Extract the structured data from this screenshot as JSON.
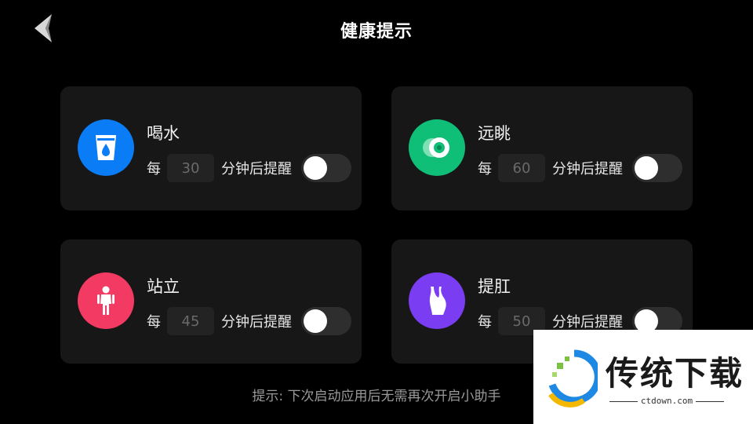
{
  "header": {
    "title": "健康提示",
    "back_icon": "chevron-left-icon"
  },
  "reminders": [
    {
      "name": "喝水",
      "every": "每",
      "minutes": "30",
      "after": "分钟后提醒",
      "enabled": false,
      "icon": "water-cup-icon",
      "color": "#0a7cf5"
    },
    {
      "name": "远眺",
      "every": "每",
      "minutes": "60",
      "after": "分钟后提醒",
      "enabled": false,
      "icon": "eye-icon",
      "color": "#0fbf78"
    },
    {
      "name": "站立",
      "every": "每",
      "minutes": "45",
      "after": "分钟后提醒",
      "enabled": false,
      "icon": "standing-person-icon",
      "color": "#f33a63"
    },
    {
      "name": "提肛",
      "every": "每",
      "minutes": "50",
      "after": "分钟后提醒",
      "enabled": false,
      "icon": "body-figure-icon",
      "color": "#7a3df2"
    }
  ],
  "tip": "提示: 下次启动应用后无需再次开启小助手",
  "watermark": {
    "text": "传统下载",
    "url": "ctdown.com"
  }
}
